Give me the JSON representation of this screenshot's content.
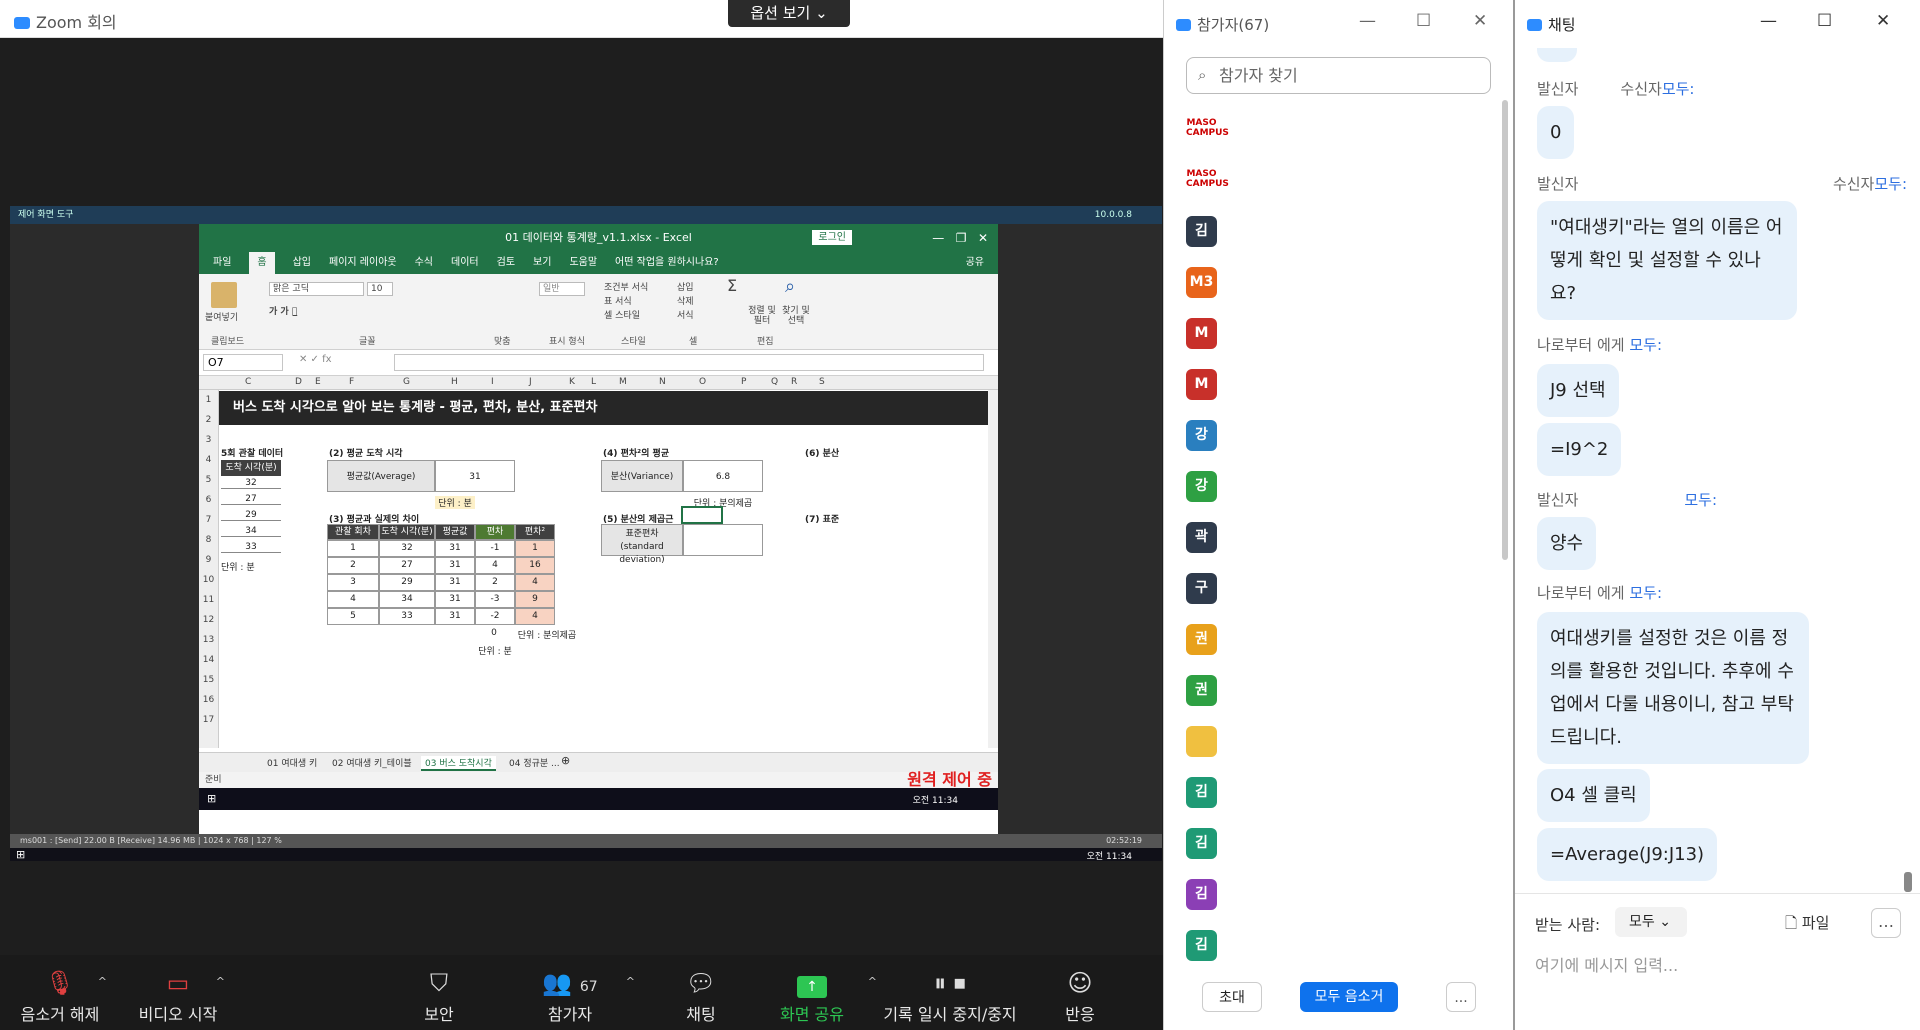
{
  "zoom": {
    "window_title": "Zoom 회의",
    "options_button": "옵션 보기 ⌄",
    "toolbar": [
      {
        "label": "음소거 해제",
        "icon": "mic-muted-icon"
      },
      {
        "label": "비디오 시작",
        "icon": "video-off-icon"
      },
      {
        "label": "보안",
        "icon": "shield-icon"
      },
      {
        "label": "참가자",
        "icon": "participants-icon",
        "count": "67"
      },
      {
        "label": "채팅",
        "icon": "chat-icon"
      },
      {
        "label": "화면 공유",
        "icon": "share-screen-icon"
      },
      {
        "label": "기록 일시 중지/중지",
        "icon": "record-icon"
      },
      {
        "label": "반응",
        "icon": "emoji-icon"
      }
    ]
  },
  "remote": {
    "top_bar": "제어  화면  도구",
    "top_right": "10.0.0.8",
    "bottom_bar": "ms001 : [Send] 22.00 B  [Receive] 14.96 MB  |  1024 x 768  |  127 %",
    "bottom_time": "02:52:19",
    "win_time": "오전 11:34",
    "remote_label": "원격 제어 중"
  },
  "excel": {
    "title": "01 데이터와 통계량_v1.1.xlsx  -  Excel",
    "login": "로그인",
    "tabs": [
      "파일",
      "홈",
      "삽입",
      "페이지 레이아웃",
      "수식",
      "데이터",
      "검토",
      "보기",
      "도움말",
      "어떤 작업을 원하시나요?",
      "공유"
    ],
    "ribbon": {
      "font": "맑은 고딕",
      "size": "10",
      "number_format": "일반",
      "groups": [
        "클립보드",
        "글꼴",
        "맞춤",
        "표시 형식",
        "스타일",
        "셀",
        "편집"
      ],
      "paste": "붙여넣기",
      "cond": "조건부 서식",
      "table": "표 서식",
      "cellstyle": "셀 스타일",
      "insert": "삽입",
      "delete": "삭제",
      "format": "서식",
      "sort": "정렬 및 필터",
      "find": "찾기 및 선택"
    },
    "name_box": "O7",
    "columns": [
      "C",
      "D",
      "E",
      "F",
      "G",
      "H",
      "I",
      "J",
      "K",
      "L",
      "M",
      "N",
      "O",
      "P",
      "Q",
      "R",
      "S"
    ],
    "rows": [
      "1",
      "2",
      "3",
      "4",
      "5",
      "6",
      "7",
      "8",
      "9",
      "10",
      "11",
      "12",
      "13",
      "14",
      "15",
      "16",
      "17"
    ],
    "sheet_title": "버스 도착 시각으로 알아 보는 통계량 - 평균, 편차, 분산, 표준편차",
    "obs": {
      "title": "5회 관찰 데이터",
      "header": "도착 시각(분)",
      "values": [
        "32",
        "27",
        "29",
        "34",
        "33"
      ],
      "unit": "단위 : 분"
    },
    "avg": {
      "title": "(2) 평균 도착 시각",
      "label": "평균값(Average)",
      "value": "31",
      "unit": "단위 : 분"
    },
    "diff": {
      "title": "(3) 평균과 실제의 차이",
      "headers": [
        "관찰 회차",
        "도착 시각(분)",
        "평균값",
        "편차",
        "편차²"
      ],
      "rows": [
        [
          "1",
          "32",
          "31",
          "-1",
          "1"
        ],
        [
          "2",
          "27",
          "31",
          "4",
          "16"
        ],
        [
          "3",
          "29",
          "31",
          "2",
          "4"
        ],
        [
          "4",
          "34",
          "31",
          "-3",
          "9"
        ],
        [
          "5",
          "33",
          "31",
          "-2",
          "4"
        ]
      ],
      "sum": "0",
      "unit1": "단위 : 분의제곱",
      "unit2": "단위 : 분"
    },
    "var": {
      "title": "(4) 편차²의 평균",
      "label": "분산(Variance)",
      "value": "6.8",
      "unit": "단위 : 분의제곱"
    },
    "std": {
      "title": "(5) 분산의 제곱근",
      "label": "표준편차",
      "label2": "(standard deviation)"
    },
    "cut1": "(6) 분산",
    "cut2": "(7) 표준",
    "sheet_tabs": [
      "01 여대생 키",
      "02 여대생 키_테이블",
      "03 버스 도착시각",
      "04 정규분 ..."
    ],
    "status": "준비"
  },
  "participants": {
    "title": "참가자(67)",
    "search_placeholder": "참가자 찾기",
    "list": [
      {
        "initial": "MASO CAMPUS",
        "color": "#ffffff",
        "logo": true
      },
      {
        "initial": "MASO CAMPUS",
        "color": "#ffffff",
        "logo": true
      },
      {
        "initial": "김",
        "color": "#2f3b4c"
      },
      {
        "initial": "M3",
        "color": "#e8641b"
      },
      {
        "initial": "M",
        "color": "#c8302a"
      },
      {
        "initial": "M",
        "color": "#c8302a"
      },
      {
        "initial": "강",
        "color": "#2a7fbf"
      },
      {
        "initial": "강",
        "color": "#2ea043"
      },
      {
        "initial": "곽",
        "color": "#2f3b4c"
      },
      {
        "initial": "구",
        "color": "#2f3b4c"
      },
      {
        "initial": "권",
        "color": "#e8a11b"
      },
      {
        "initial": "권",
        "color": "#2ea043"
      },
      {
        "initial": "",
        "color": "#f0c040"
      },
      {
        "initial": "김",
        "color": "#1f9a75"
      },
      {
        "initial": "김",
        "color": "#1f9a75"
      },
      {
        "initial": "김",
        "color": "#8b3fb5"
      },
      {
        "initial": "김",
        "color": "#1f9a75"
      }
    ],
    "invite": "초대",
    "mute_all": "모두 음소거",
    "more": "..."
  },
  "chat": {
    "title": "채팅",
    "messages": [
      {
        "from": "발신자",
        "to_prefix": "수신자",
        "to": "모두:",
        "text": "0"
      },
      {
        "from": "발신자",
        "to_prefix": "수신자",
        "to": "모두:",
        "text": "\"여대생키\"라는 열의 이름은 어떻게 확인 및 설정할 수 있나요?"
      },
      {
        "from": "나로부터 에게",
        "to_prefix": "",
        "to": "모두:",
        "text": "J9 선택"
      },
      {
        "text": "=I9^2"
      },
      {
        "from": "발신자",
        "to_prefix": "",
        "to": "모두:",
        "text": "양수"
      },
      {
        "from": "나로부터 에게",
        "to_prefix": "",
        "to": "모두:",
        "text": "여대생키를 설정한 것은 이름 정의를 활용한 것입니다. 추후에 수업에서 다룰 내용이니, 참고 부탁드립니다."
      },
      {
        "text": "O4 셀 클릭"
      },
      {
        "text": "=Average(J9:J13)"
      }
    ],
    "recipient_label": "받는 사람:",
    "recipient": "모두 ⌄",
    "file": "파일",
    "input_placeholder": "여기에 메시지 입력..."
  }
}
